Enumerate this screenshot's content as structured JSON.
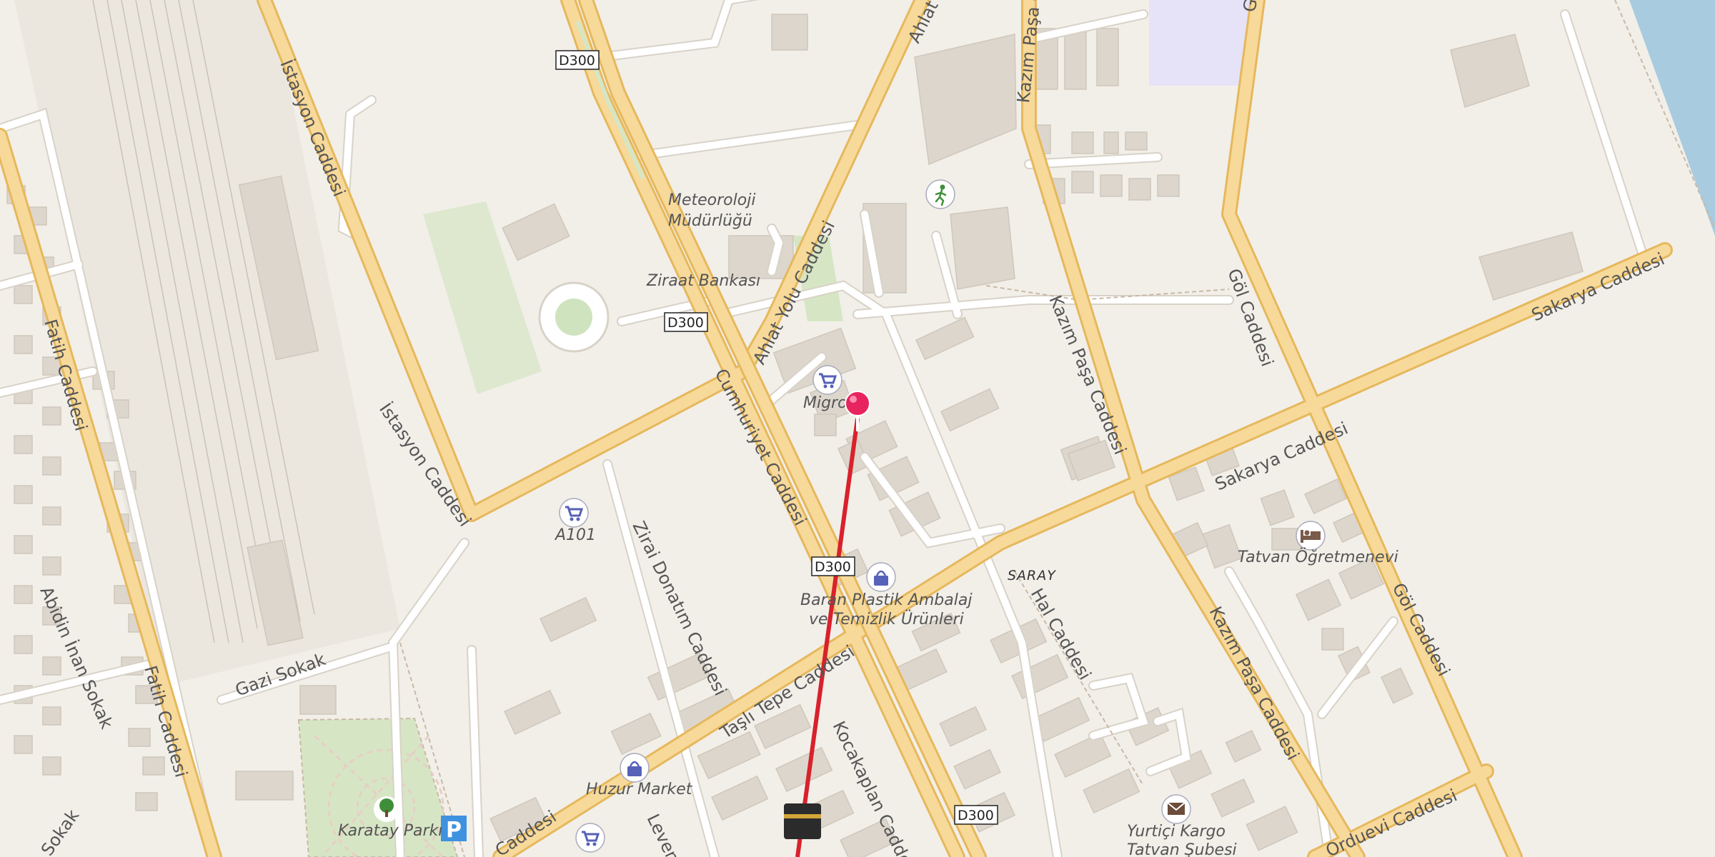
{
  "colors": {
    "background": "#f2efe9",
    "major_road": "#f7d99a",
    "major_road_casing": "#e6b85c",
    "minor_road": "#ffffff",
    "minor_road_casing": "#d8d2c8",
    "building": "#ddd6cd",
    "park": "#d6e6c5",
    "water": "#a8cbe0",
    "route_line": "#d9212c",
    "marker": "#e8245e",
    "poi_icon": "#5661b8"
  },
  "streets": {
    "istasyon_1": "İstasyon Caddesi",
    "istasyon_2": "İstasyon Caddesi",
    "fatih_1": "Fatih Caddesi",
    "fatih_2": "Fatih Caddesi",
    "abidin": "Abidin İnan Sokak",
    "sokak_bottom": "Sokak",
    "gazi": "Gazi Sokak",
    "ziraiDonatim": "Zirai Donatım Caddesi",
    "tasliTepe": "Taşlı Tepe Caddesi",
    "caddesi_bottom": "Caddesi",
    "leven": "Leven",
    "kocakaplan": "Kocakaplan Cadde",
    "cumhuriyet": "Cumhuriyet Caddesi",
    "ahlatYolu": "Ahlat Yolu Caddesi",
    "ahlat_top": "Ahlat",
    "kazimPasa_top": "Kazım Paşa C",
    "kazimPasa_mid": "Kazım Paşa Caddesi",
    "kazimPasa_low": "Kazım Paşa Caddesi",
    "hal": "Hal Caddesi",
    "sakarya_1": "Sakarya Caddesi",
    "sakarya_2": "Sakarya Caddesi",
    "gol_1": "Göl Caddesi",
    "gol_2": "Göl Caddesi",
    "gol_top": "G",
    "orduevi": "Orduevi Caddesi"
  },
  "shields": {
    "top": "D300",
    "middle": "D300",
    "lower": "D300",
    "bottom": "D300"
  },
  "pois": {
    "meteoroloji_1": "Meteoroloji",
    "meteoroloji_2": "Müdürlüğü",
    "ziraat": "Ziraat Bankası",
    "migros": "Migros",
    "a101": "A101",
    "baran_1": "Baran Plastik Ambalaj",
    "baran_2": "ve Temizlik Ürünleri",
    "huzur": "Huzur Market",
    "karatay": "Karatay Parkı",
    "ogretmenevi": "Tatvan Öğretmenevi",
    "yurtici_1": "Yurtiçi Kargo",
    "yurtici_2": "Tatvan Şubesi"
  },
  "district": "SARAY",
  "icons": {
    "migros": "shopping-cart-icon",
    "a101": "shopping-cart-icon",
    "baran": "shopping-bag-icon",
    "huzur": "shopping-bag-icon",
    "bottom_shop": "shopping-cart-icon",
    "park": "tree-icon",
    "parking": "parking-icon",
    "hotel": "bed-icon",
    "post": "envelope-icon",
    "sports": "running-person-icon",
    "mosque": "kaaba-icon",
    "marker": "location-pin-icon"
  }
}
